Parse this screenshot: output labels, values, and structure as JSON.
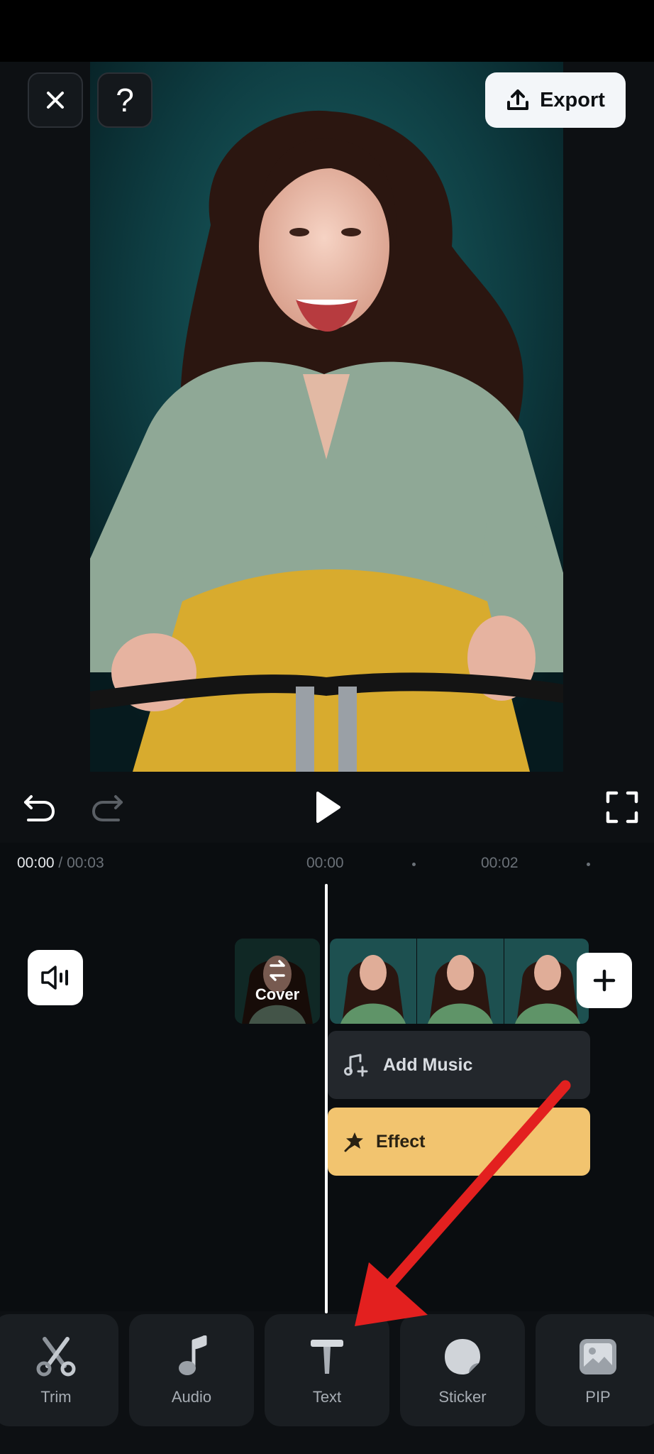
{
  "header": {
    "export_label": "Export"
  },
  "timeline": {
    "current_time": "00:00",
    "total_time": " / 00:03",
    "ruler_labels": [
      "00:00",
      "00:02"
    ]
  },
  "tracks": {
    "cover_label": "Cover",
    "add_music_label": "Add Music",
    "effect_label": "Effect"
  },
  "toolbar": {
    "items": [
      {
        "label": "Trim",
        "icon": "scissors-icon"
      },
      {
        "label": "Audio",
        "icon": "music-note-icon"
      },
      {
        "label": "Text",
        "icon": "text-icon"
      },
      {
        "label": "Sticker",
        "icon": "sticker-icon"
      },
      {
        "label": "PIP",
        "icon": "image-icon"
      }
    ]
  },
  "colors": {
    "background": "#0d1013",
    "export_button": "#f3f6f9",
    "effect_track": "#f2c46f",
    "music_track": "#23272c",
    "annotation_arrow": "#e3201f"
  }
}
